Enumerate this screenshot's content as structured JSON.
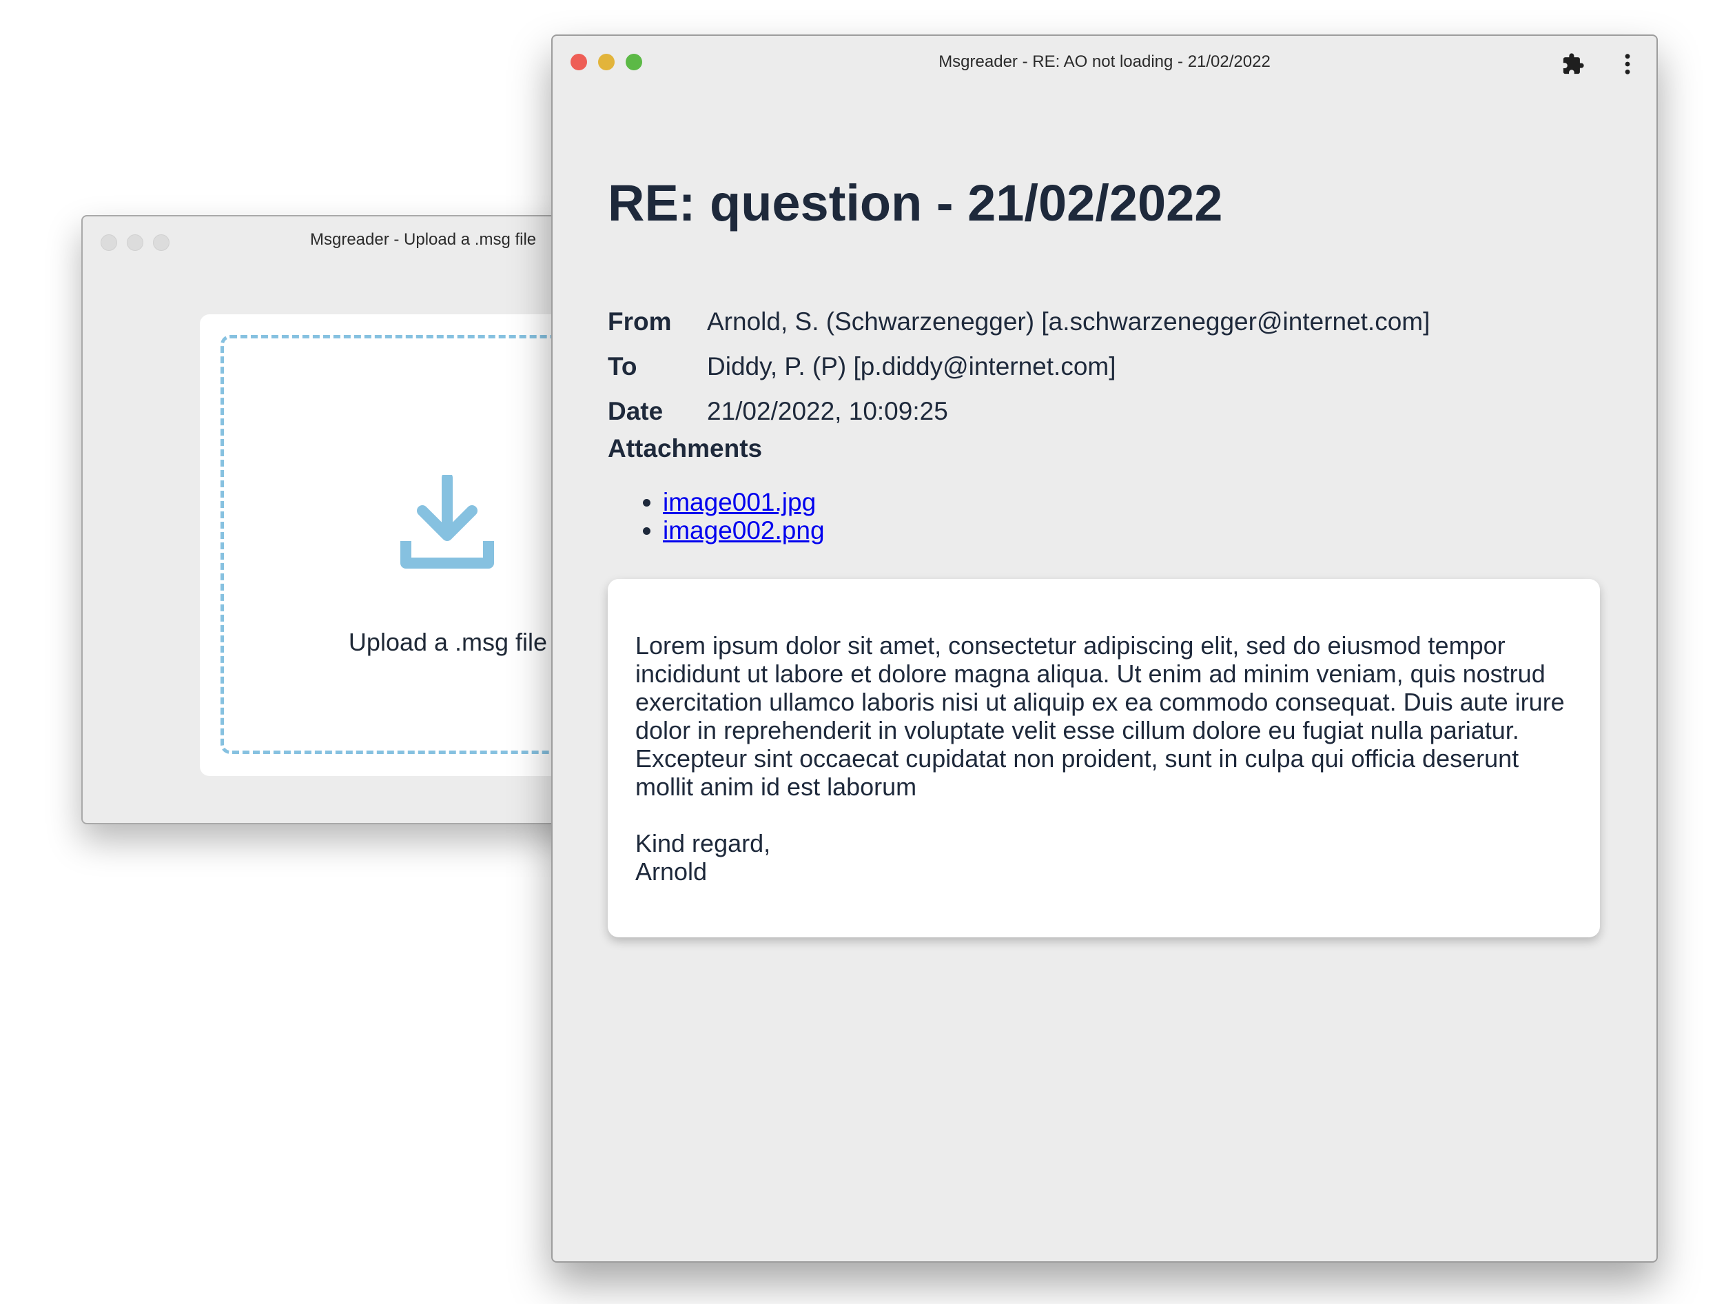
{
  "back_window": {
    "title": "Msgreader - Upload a .msg file",
    "upload_label": "Upload a .msg file",
    "accent": "#86c1e0",
    "icon": "download-icon"
  },
  "front_window": {
    "title": "Msgreader - RE: AO not loading - 21/02/2022",
    "toolbar_icons": [
      "puzzle-extension-icon",
      "kebab-menu-icon"
    ],
    "subject": "RE: question - 21/02/2022",
    "fields": {
      "from_label": "From",
      "from_value": "Arnold, S. (Schwarzenegger) [a.schwarzenegger@internet.com]",
      "to_label": "To",
      "to_value": "Diddy, P. (P) [p.diddy@internet.com]",
      "date_label": "Date",
      "date_value": "21/02/2022, 10:09:25"
    },
    "attachments_heading": "Attachments",
    "attachments": [
      "image001.jpg",
      "image002.png"
    ],
    "body": "Lorem ipsum dolor sit amet, consectetur adipiscing elit, sed do eiusmod tempor\nincididunt ut labore et dolore magna aliqua. Ut enim ad minim veniam, quis nostrud\nexercitation ullamco laboris nisi ut aliquip ex ea commodo consequat. Duis aute irure\ndolor in reprehenderit in voluptate velit esse cillum dolore eu fugiat nulla pariatur.\nExcepteur sint occaecat cupidatat non proident, sunt in culpa qui officia deserunt\nmollit anim id est laborum\n\nKind regard,\nArnold",
    "link_color": "#0000ee",
    "traffic_colors": [
      "#ee5e56",
      "#e2b43b",
      "#5cb946"
    ]
  }
}
